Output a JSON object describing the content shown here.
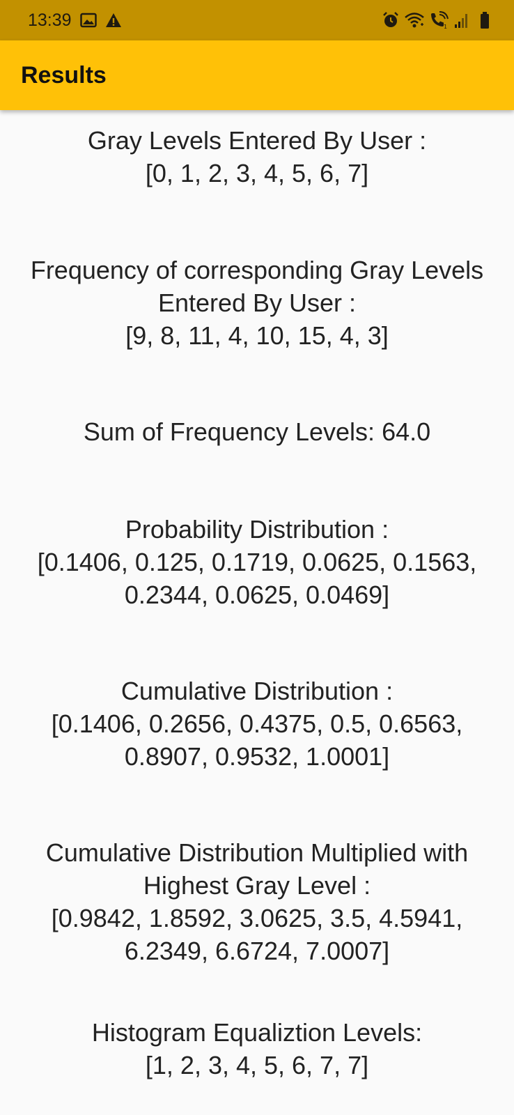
{
  "status_bar": {
    "time": "13:39",
    "icons": [
      "image-icon",
      "warning-icon",
      "alarm-icon",
      "wifi-icon",
      "wifi-calling-icon",
      "signal-icon",
      "battery-icon"
    ]
  },
  "app_bar": {
    "title": "Results"
  },
  "colors": {
    "status_bar": "#c29100",
    "app_bar": "#ffc107",
    "background": "#fafafa",
    "text": "#222222"
  },
  "sections": {
    "gray_levels": {
      "label": "Gray Levels Entered By User :",
      "value": "[0, 1, 2, 3, 4, 5, 6, 7]"
    },
    "frequency": {
      "label_line1": "Frequency of corresponding Gray Levels",
      "label_line2": "Entered By User :",
      "value": "[9, 8, 11, 4, 10, 15, 4, 3]"
    },
    "sum": {
      "text": "Sum of Frequency Levels: 64.0"
    },
    "probability": {
      "label": "Probability Distribution :",
      "value_line1": "[0.1406, 0.125, 0.1719, 0.0625, 0.1563,",
      "value_line2": "0.2344, 0.0625, 0.0469]"
    },
    "cumulative": {
      "label": "Cumulative Distribution :",
      "value_line1": "[0.1406, 0.2656, 0.4375, 0.5, 0.6563,",
      "value_line2": "0.8907, 0.9532, 1.0001]"
    },
    "multiplied": {
      "label_line1": "Cumulative Distribution Multiplied with",
      "label_line2": "Highest Gray Level :",
      "value_line1": "[0.9842, 1.8592, 3.0625, 3.5, 4.5941,",
      "value_line2": "6.2349, 6.6724, 7.0007]"
    },
    "equalization": {
      "label": "Histogram Equaliztion Levels:",
      "value": "[1, 2, 3, 4, 5, 6, 7, 7]"
    }
  }
}
